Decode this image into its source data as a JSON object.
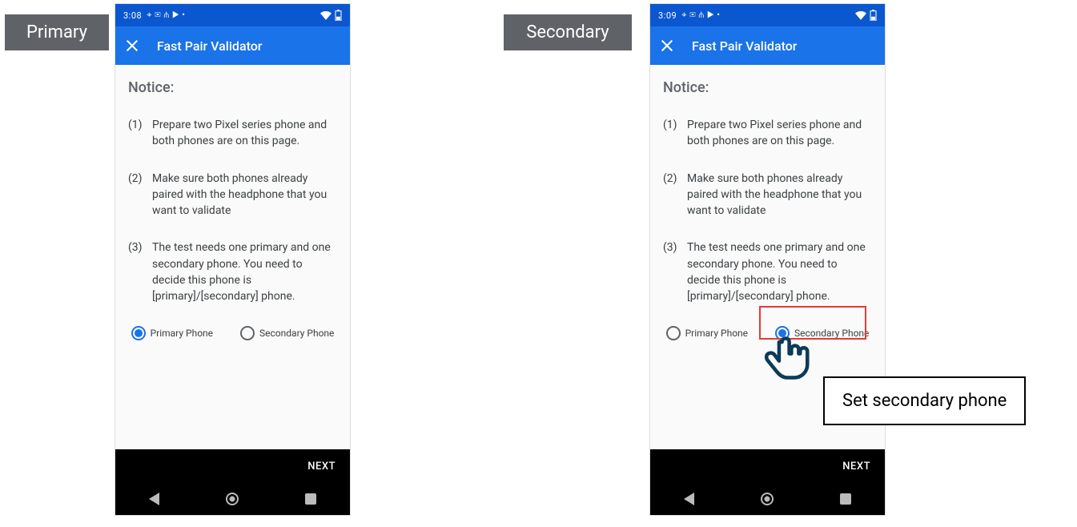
{
  "labels": {
    "primary_tab": "Primary",
    "secondary_tab": "Secondary"
  },
  "phones": {
    "left": {
      "time": "3:08",
      "status_icons_text": "⌖ ✉ ⋔ ▶ •",
      "app_title": "Fast Pair Validator",
      "notice_title": "Notice:",
      "steps": [
        {
          "num": "(1)",
          "text": "Prepare two Pixel series phone and both phones are on this page."
        },
        {
          "num": "(2)",
          "text": "Make sure both phones already paired with the headphone that you want to validate"
        },
        {
          "num": "(3)",
          "text": "The test needs one primary and one secondary phone. You need to decide this phone is [primary]/[secondary] phone."
        }
      ],
      "radio_primary_label": "Primary Phone",
      "radio_secondary_label": "Secondary Phone",
      "selected": "primary",
      "next_label": "NEXT"
    },
    "right": {
      "time": "3:09",
      "status_icons_text": "⌖ ✉ ⋔ ▶ •",
      "app_title": "Fast Pair Validator",
      "notice_title": "Notice:",
      "steps": [
        {
          "num": "(1)",
          "text": "Prepare two Pixel series phone and both phones are on this page."
        },
        {
          "num": "(2)",
          "text": "Make sure both phones already paired with the headphone that you want to validate"
        },
        {
          "num": "(3)",
          "text": "The test needs one primary and one secondary phone. You need to decide this phone is [primary]/[secondary] phone."
        }
      ],
      "radio_primary_label": "Primary Phone",
      "radio_secondary_label": "Secondary Phone",
      "selected": "secondary",
      "next_label": "NEXT"
    }
  },
  "callout": "Set secondary phone"
}
